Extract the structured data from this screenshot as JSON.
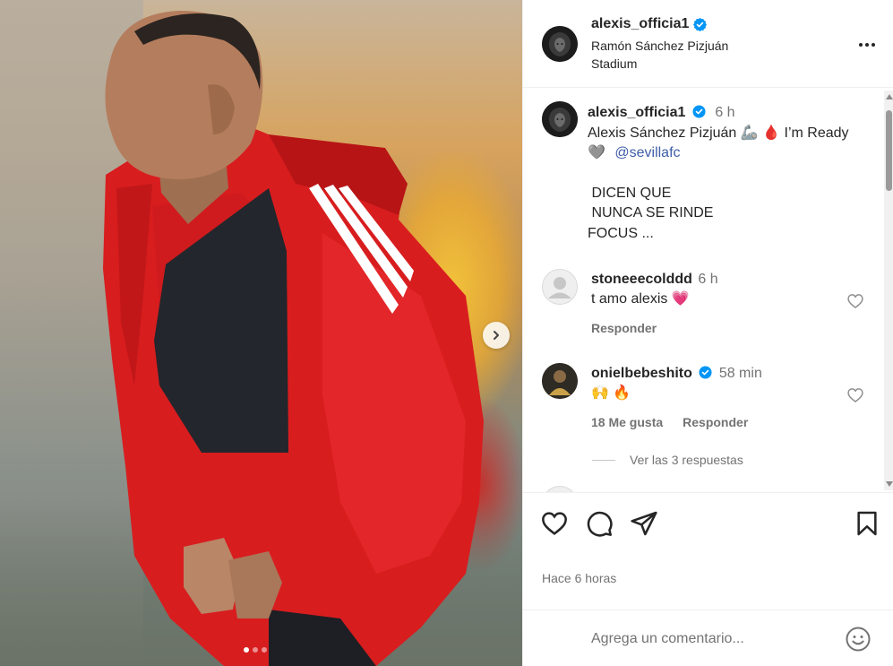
{
  "post": {
    "username": "alexis_officia1",
    "location": "Ramón Sánchez Pizjuán Stadium",
    "carousel": {
      "total": 3,
      "current": 1
    }
  },
  "caption": {
    "username": "alexis_officia1",
    "time": "6 h",
    "line1": "Alexis Sánchez Pizjuán 🦾 🩸 I’m Ready",
    "line2_emoji": "🩶",
    "mention": "@sevillafc",
    "line3": " DICEN QUE",
    "line4": " NUNCA SE RINDE",
    "line5": "FOCUS ..."
  },
  "comments": [
    {
      "username": "stoneeecolddd",
      "time": "6 h",
      "text": "t amo alexis 💗",
      "reply_label": "Responder",
      "likes_label": "",
      "verified": false
    },
    {
      "username": "onielbebeshito",
      "time": "58 min",
      "text": "🙌 🔥",
      "likes_label": "18 Me gusta",
      "reply_label": "Responder",
      "verified": true,
      "view_replies": "Ver las 3 respuestas"
    }
  ],
  "footer": {
    "posted_time": "Hace 6 horas",
    "comment_placeholder": "Agrega un comentario..."
  },
  "icons": {
    "verified_color": "#0095f6",
    "link_color": "#3e5ea8",
    "like": "heart-icon",
    "comment": "comment-icon",
    "share": "share-icon",
    "save": "bookmark-icon",
    "emoji": "emoji-icon"
  }
}
